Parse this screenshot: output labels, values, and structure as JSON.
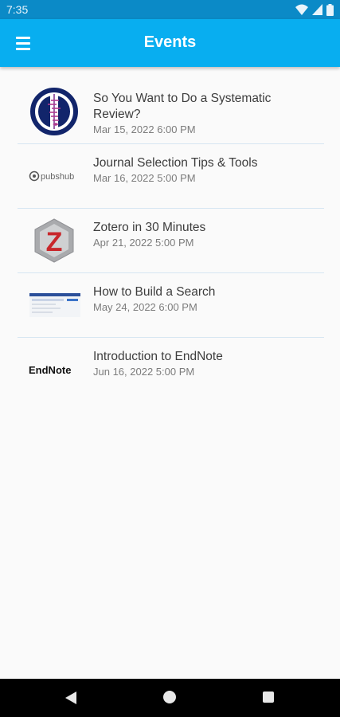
{
  "status_bar": {
    "time": "7:35",
    "icons": [
      "wifi-icon",
      "signal-icon",
      "battery-icon"
    ]
  },
  "app_bar": {
    "title": "Events",
    "menu_icon": "menu-icon",
    "color": "#08aef0"
  },
  "events": [
    {
      "title": "So You Want to Do a Systematic Review?",
      "date": "Mar 15, 2022 6:00 PM",
      "logo": "cochrane-logo"
    },
    {
      "title": "Journal Selection Tips & Tools",
      "date": "Mar 16, 2022 5:00 PM",
      "logo": "pubshub-logo",
      "logo_text": "pubshub"
    },
    {
      "title": "Zotero in 30 Minutes",
      "date": "Apr 21, 2022 5:00 PM",
      "logo": "zotero-logo",
      "logo_text": "Z"
    },
    {
      "title": "How to Build a Search",
      "date": "May 24, 2022 6:00 PM",
      "logo": "search-screenshot-thumbnail"
    },
    {
      "title": "Introduction to EndNote",
      "date": "Jun 16, 2022 5:00 PM",
      "logo": "endnote-logo",
      "logo_text": "EndNote"
    }
  ],
  "nav_bar": {
    "icons": [
      "back-icon",
      "home-icon",
      "recents-icon"
    ]
  }
}
